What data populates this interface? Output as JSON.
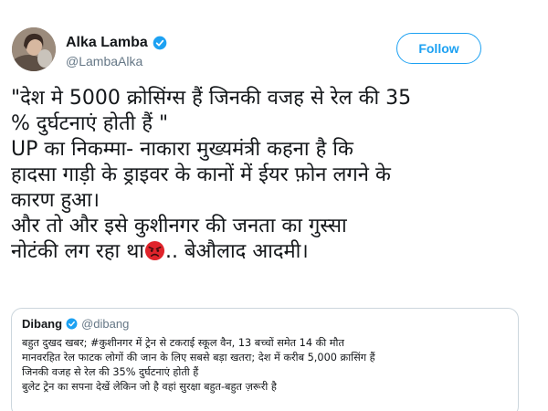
{
  "author": {
    "name": "Alka Lamba",
    "handle": "@LambaAlka",
    "verified": true
  },
  "follow_button": {
    "label": "Follow"
  },
  "tweet": {
    "lines": [
      "\"देश मे 5000 क्रोसिंग्स हैं जिनकी वजह से रेल की 35",
      "% दुर्घटनाएं होती हैं \"",
      "UP का निकम्मा- नाकारा मुख्यमंत्री कहना है कि",
      "हादसा गाड़ी के ड्राइवर के कानों में ईयर फ़ोन लगने के",
      "कारण हुआ।",
      "और तो और इसे कुशीनगर की जनता का गुस्सा"
    ],
    "last_line_before_emoji": "नोटंकी लग रहा था",
    "emoji": "angry-face-icon",
    "last_line_after_emoji": ".. बेऔलाद आदमी।"
  },
  "quoted_tweet": {
    "name": "Dibang",
    "handle": "@dibang",
    "verified": true,
    "lines": [
      "बहुत दुखद खबर; #कुशीनगर में ट्रेन से टकराई स्कूल वैन, 13 बच्चों समेत 14 की मौत",
      "मानवरहित रेल फाटक लोगों की जान के लिए सबसे बड़ा खतरा; देश में करीब 5,000 क्रासिंग हैं",
      "जिनकी वजह से रेल की 35% दुर्घटनाएं होती हैं",
      "बुलेट ट्रेन का सपना देखें लेकिन जो है वहां सुरक्षा बहुत-बहुत ज़रूरी है"
    ]
  },
  "colors": {
    "accent": "#1da1f2",
    "text": "#14171a",
    "muted": "#657786",
    "border": "#ccd6dd"
  }
}
